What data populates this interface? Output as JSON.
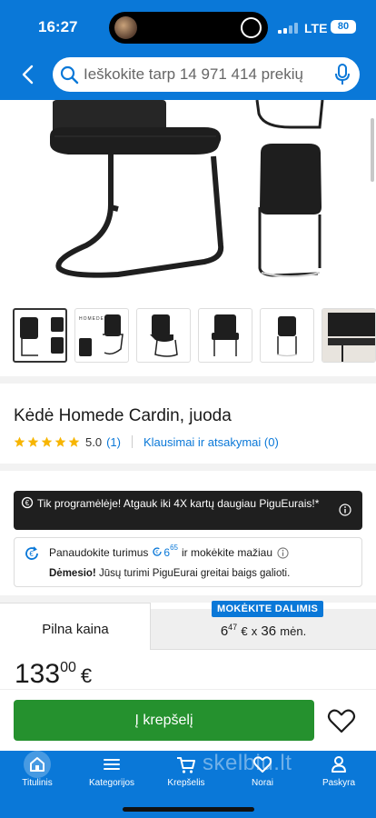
{
  "status_bar": {
    "time": "16:27",
    "network": "LTE",
    "battery": "80"
  },
  "search": {
    "placeholder": "Ieškokite tarp 14 971 414 prekių"
  },
  "gallery": {
    "thumbnail_caption": "HOMEDE",
    "thumbnail_count": 6,
    "active_index": 0
  },
  "product": {
    "title": "Kėdė Homede Cardin, juoda",
    "rating_score": "5.0",
    "rating_count": "(1)",
    "qa_link": "Klausimai ir atsakymai (0)"
  },
  "promo_app": {
    "text": "Tik programėlėje! Atgauk iki 4X kartų daugiau PiguEurais!*"
  },
  "promo_points": {
    "prefix": "Panaudokite turimus",
    "points_int": "6",
    "points_dec": "65",
    "suffix": "ir mokėkite mažiau",
    "warning_bold": "Dėmesio!",
    "warning_text": "Jūsų turimi PiguEurai greitai baigs galioti."
  },
  "price_tabs": {
    "full_label": "Pilna kaina",
    "installment_badge": "MOKĖKITE DALIMIS",
    "installment_int": "6",
    "installment_dec": "47",
    "installment_currency": "€",
    "installment_x": "x",
    "installment_months": "36",
    "installment_unit": "mėn."
  },
  "price": {
    "int": "133",
    "dec": "00",
    "currency": "€"
  },
  "cart": {
    "button_label": "Į krepšelį"
  },
  "nav": {
    "items": [
      {
        "label": "Titulinis",
        "icon": "home-icon"
      },
      {
        "label": "Kategorijos",
        "icon": "menu-icon"
      },
      {
        "label": "Krepšelis",
        "icon": "cart-icon"
      },
      {
        "label": "Norai",
        "icon": "heart-icon"
      },
      {
        "label": "Paskyra",
        "icon": "user-icon"
      }
    ],
    "watermark": "skelbiu.lt"
  },
  "colors": {
    "brand_blue": "#0a78d8",
    "cart_green": "#25912e",
    "star_yellow": "#f7b500",
    "dark_promo": "#1f1f1f"
  }
}
